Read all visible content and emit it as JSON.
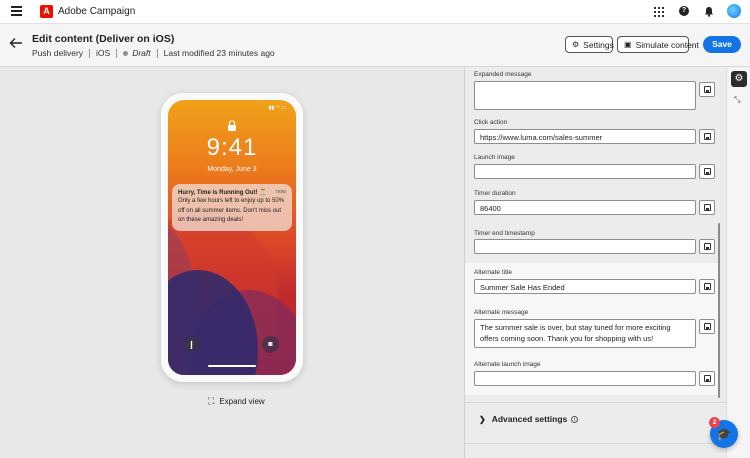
{
  "topbar": {
    "app_title": "Adobe Campaign",
    "logo_letter": "A",
    "icons": [
      "menu-icon",
      "adobe-logo",
      "apps-grid-icon",
      "help-icon",
      "bell-icon",
      "avatar"
    ]
  },
  "header": {
    "title": "Edit content (Deliver on iOS)",
    "meta": {
      "type": "Push delivery",
      "platform": "iOS",
      "status": "Draft",
      "modified": "Last modified 23 minutes ago"
    },
    "buttons": {
      "settings": "Settings",
      "simulate": "Simulate content",
      "save": "Save"
    }
  },
  "preview": {
    "time": "9:41",
    "date": "Monday, June 3",
    "notification": {
      "title": "Hurry, Time is Running Out! ⏳",
      "time": "now",
      "body": "Only a few hours left to enjoy up to 50% off on all summer items. Don't miss out on these amazing deals!"
    },
    "expand_label": "Expand view"
  },
  "form": {
    "expanded_message": {
      "label": "Expanded message",
      "value": ""
    },
    "click_action": {
      "label": "Click action",
      "value": "https://www.luma.com/sales-summer"
    },
    "launch_image": {
      "label": "Launch image",
      "value": ""
    },
    "timer_duration": {
      "label": "Timer duration",
      "value": "86400"
    },
    "timer_end_timestamp": {
      "label": "Timer end timestamp",
      "value": ""
    },
    "alternate_title": {
      "label": "Alternate title",
      "value": "Summer Sale Has Ended"
    },
    "alternate_message": {
      "label": "Alternate message",
      "value": "The summer sale is over, but stay tuned for more exciting offers coming soon. Thank you for shopping with us!"
    },
    "alternate_launch_image": {
      "label": "Alternate launch image",
      "value": ""
    },
    "advanced_settings": "Advanced settings"
  },
  "help_badge": "2",
  "colors": {
    "accent": "#1473e6",
    "brand": "#eb1000",
    "badge": "#e34850"
  }
}
